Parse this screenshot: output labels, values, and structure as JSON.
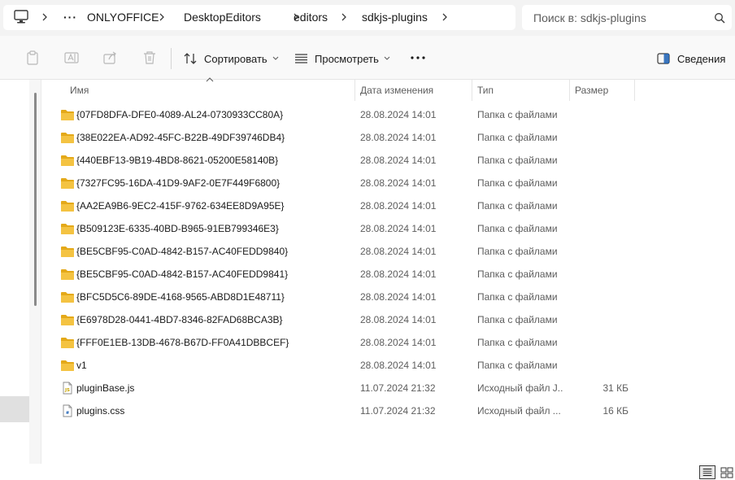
{
  "address": {
    "crumbs": [
      "ONLYOFFICE",
      "DesktopEditors",
      "editors",
      "sdkjs-plugins"
    ]
  },
  "search": {
    "placeholder": "Поиск в: sdkjs-plugins"
  },
  "toolbar": {
    "sort_label": "Сортировать",
    "view_label": "Просмотреть",
    "details_label": "Сведения"
  },
  "columns": {
    "name": "Имя",
    "date": "Дата изменения",
    "type": "Тип",
    "size": "Размер"
  },
  "files": [
    {
      "name": "{07FD8DFA-DFE0-4089-AL24-0730933CC80A}",
      "date": "28.08.2024 14:01",
      "type": "Папка с файлами",
      "size": "",
      "icon": "folder-icon"
    },
    {
      "name": "{38E022EA-AD92-45FC-B22B-49DF39746DB4}",
      "date": "28.08.2024 14:01",
      "type": "Папка с файлами",
      "size": "",
      "icon": "folder-icon"
    },
    {
      "name": "{440EBF13-9B19-4BD8-8621-05200E58140B}",
      "date": "28.08.2024 14:01",
      "type": "Папка с файлами",
      "size": "",
      "icon": "folder-icon"
    },
    {
      "name": "{7327FC95-16DA-41D9-9AF2-0E7F449F6800}",
      "date": "28.08.2024 14:01",
      "type": "Папка с файлами",
      "size": "",
      "icon": "folder-icon"
    },
    {
      "name": "{AA2EA9B6-9EC2-415F-9762-634EE8D9A95E}",
      "date": "28.08.2024 14:01",
      "type": "Папка с файлами",
      "size": "",
      "icon": "folder-icon"
    },
    {
      "name": "{B509123E-6335-40BD-B965-91EB799346E3}",
      "date": "28.08.2024 14:01",
      "type": "Папка с файлами",
      "size": "",
      "icon": "folder-icon"
    },
    {
      "name": "{BE5CBF95-C0AD-4842-B157-AC40FEDD9840}",
      "date": "28.08.2024 14:01",
      "type": "Папка с файлами",
      "size": "",
      "icon": "folder-icon"
    },
    {
      "name": "{BE5CBF95-C0AD-4842-B157-AC40FEDD9841}",
      "date": "28.08.2024 14:01",
      "type": "Папка с файлами",
      "size": "",
      "icon": "folder-icon"
    },
    {
      "name": "{BFC5D5C6-89DE-4168-9565-ABD8D1E48711}",
      "date": "28.08.2024 14:01",
      "type": "Папка с файлами",
      "size": "",
      "icon": "folder-icon"
    },
    {
      "name": "{E6978D28-0441-4BD7-8346-82FAD68BCA3B}",
      "date": "28.08.2024 14:01",
      "type": "Папка с файлами",
      "size": "",
      "icon": "folder-icon"
    },
    {
      "name": "{FFF0E1EB-13DB-4678-B67D-FF0A41DBBCEF}",
      "date": "28.08.2024 14:01",
      "type": "Папка с файлами",
      "size": "",
      "icon": "folder-icon"
    },
    {
      "name": "v1",
      "date": "28.08.2024 14:01",
      "type": "Папка с файлами",
      "size": "",
      "icon": "folder-icon"
    },
    {
      "name": "pluginBase.js",
      "date": "11.07.2024 21:32",
      "type": "Исходный файл J...",
      "size": "31 КБ",
      "icon": "js-file-icon"
    },
    {
      "name": "plugins.css",
      "date": "11.07.2024 21:32",
      "type": "Исходный файл ...",
      "size": "16 КБ",
      "icon": "css-file-icon"
    }
  ],
  "colors": {
    "folder": "#f4c342",
    "folder_dark": "#e4a919",
    "accent": "#1a5fb4"
  }
}
